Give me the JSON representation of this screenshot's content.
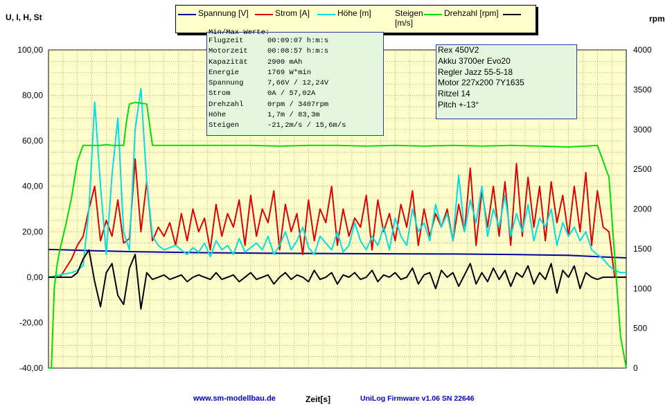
{
  "chart_data": {
    "type": "line",
    "left_axis_label": "U, I, H, St",
    "right_axis_label": "rpm",
    "xlabel": "Zeit[s]",
    "ylim_left": [
      -40,
      100
    ],
    "ylim_right": [
      0,
      4000
    ],
    "left_ticks": [
      "100,00",
      "80,00",
      "60,00",
      "40,00",
      "20,00",
      "0,00",
      "-20,00",
      "-40,00"
    ],
    "right_ticks": [
      "4000",
      "3500",
      "3000",
      "2500",
      "2000",
      "1500",
      "1000",
      "500",
      "0"
    ],
    "grid": true,
    "legend_position": "top",
    "x_range": [
      0,
      100
    ],
    "series": [
      {
        "name": "Spannung [V]",
        "color": "#0000a0",
        "axis": "left",
        "x": [
          0,
          3,
          8,
          15,
          25,
          40,
          50,
          60,
          70,
          80,
          90,
          97,
          100
        ],
        "y": [
          12.2,
          12.0,
          11.6,
          11.2,
          10.8,
          10.5,
          10.4,
          10.3,
          10.2,
          10.0,
          9.6,
          8.8,
          8.5
        ]
      },
      {
        "name": "Strom [A]",
        "color": "#e00000",
        "axis": "left",
        "x": [
          0,
          2,
          4,
          5,
          6,
          7,
          8,
          9,
          10,
          11,
          12,
          13,
          14,
          15,
          16,
          17,
          18,
          19,
          20,
          21,
          22,
          23,
          24,
          25,
          26,
          27,
          28,
          29,
          30,
          31,
          32,
          33,
          34,
          35,
          36,
          37,
          38,
          39,
          40,
          41,
          42,
          43,
          44,
          45,
          46,
          47,
          48,
          49,
          50,
          51,
          52,
          53,
          54,
          55,
          56,
          57,
          58,
          59,
          60,
          61,
          62,
          63,
          64,
          65,
          66,
          67,
          68,
          69,
          70,
          71,
          72,
          73,
          74,
          75,
          76,
          77,
          78,
          79,
          80,
          81,
          82,
          83,
          84,
          85,
          86,
          87,
          88,
          89,
          90,
          91,
          92,
          93,
          94,
          95,
          96,
          97,
          98,
          99,
          100
        ],
        "y": [
          0,
          0,
          8,
          14,
          18,
          30,
          40,
          16,
          25,
          18,
          34,
          15,
          17,
          52,
          20,
          42,
          16,
          22,
          18,
          24,
          14,
          28,
          16,
          30,
          20,
          26,
          12,
          32,
          18,
          28,
          22,
          34,
          14,
          36,
          18,
          30,
          24,
          38,
          12,
          32,
          20,
          28,
          10,
          34,
          16,
          30,
          24,
          40,
          14,
          30,
          18,
          26,
          22,
          36,
          12,
          34,
          20,
          28,
          16,
          32,
          22,
          38,
          14,
          30,
          18,
          28,
          22,
          30,
          16,
          32,
          20,
          48,
          14,
          38,
          22,
          40,
          18,
          42,
          14,
          50,
          18,
          44,
          22,
          40,
          16,
          42,
          24,
          36,
          18,
          40,
          20,
          46,
          14,
          38,
          22,
          20,
          0,
          0,
          0
        ]
      },
      {
        "name": "Höhe [m]",
        "color": "#00e0e0",
        "axis": "left",
        "x": [
          0,
          2,
          4,
          5,
          6,
          7,
          8,
          9,
          10,
          11,
          12,
          13,
          14,
          15,
          16,
          17,
          18,
          19,
          20,
          21,
          22,
          23,
          24,
          25,
          26,
          27,
          28,
          29,
          30,
          31,
          32,
          33,
          34,
          35,
          36,
          37,
          38,
          39,
          40,
          41,
          42,
          43,
          44,
          45,
          46,
          47,
          48,
          49,
          50,
          51,
          52,
          53,
          54,
          55,
          56,
          57,
          58,
          59,
          60,
          61,
          62,
          63,
          64,
          65,
          66,
          67,
          68,
          69,
          70,
          71,
          72,
          73,
          74,
          75,
          76,
          77,
          78,
          79,
          80,
          81,
          82,
          83,
          84,
          85,
          86,
          87,
          88,
          89,
          90,
          91,
          92,
          93,
          94,
          95,
          96,
          97,
          98,
          99,
          100
        ],
        "y": [
          0,
          1,
          2,
          3,
          5,
          30,
          77,
          40,
          10,
          45,
          70,
          20,
          12,
          65,
          83,
          42,
          18,
          14,
          12,
          13,
          14,
          12,
          10,
          13,
          11,
          15,
          9,
          16,
          12,
          14,
          10,
          17,
          11,
          13,
          15,
          12,
          18,
          10,
          14,
          20,
          12,
          16,
          22,
          13,
          10,
          18,
          15,
          12,
          20,
          11,
          14,
          24,
          16,
          12,
          18,
          14,
          22,
          12,
          26,
          18,
          14,
          30,
          20,
          24,
          16,
          32,
          22,
          28,
          16,
          45,
          20,
          34,
          24,
          40,
          18,
          30,
          22,
          36,
          18,
          28,
          20,
          32,
          16,
          26,
          22,
          30,
          14,
          24,
          18,
          22,
          16,
          20,
          12,
          10,
          8,
          5,
          3,
          2,
          2
        ]
      },
      {
        "name": "Steigen [m/s]",
        "color": "#000000",
        "axis": "left",
        "x": [
          0,
          2,
          4,
          5,
          6,
          7,
          8,
          9,
          10,
          11,
          12,
          13,
          14,
          15,
          16,
          17,
          18,
          19,
          20,
          21,
          22,
          23,
          24,
          25,
          26,
          27,
          28,
          29,
          30,
          31,
          32,
          33,
          34,
          35,
          36,
          37,
          38,
          39,
          40,
          41,
          42,
          43,
          44,
          45,
          46,
          47,
          48,
          49,
          50,
          51,
          52,
          53,
          54,
          55,
          56,
          57,
          58,
          59,
          60,
          61,
          62,
          63,
          64,
          65,
          66,
          67,
          68,
          69,
          70,
          71,
          72,
          73,
          74,
          75,
          76,
          77,
          78,
          79,
          80,
          81,
          82,
          83,
          84,
          85,
          86,
          87,
          88,
          89,
          90,
          91,
          92,
          93,
          94,
          95,
          96,
          97,
          98,
          99,
          100
        ],
        "y": [
          0,
          0,
          0,
          2,
          8,
          12,
          -2,
          -13,
          2,
          6,
          -8,
          -12,
          4,
          10,
          -14,
          2,
          -1,
          0,
          1,
          -1,
          0,
          1,
          -2,
          0,
          1,
          0,
          -1,
          2,
          -1,
          0,
          1,
          -2,
          0,
          2,
          -1,
          0,
          1,
          -3,
          0,
          2,
          -1,
          1,
          0,
          -2,
          3,
          -1,
          0,
          2,
          -3,
          1,
          0,
          2,
          -1,
          0,
          3,
          -2,
          1,
          0,
          2,
          -1,
          0,
          4,
          -3,
          1,
          2,
          -5,
          3,
          0,
          2,
          -4,
          1,
          6,
          -3,
          2,
          -2,
          4,
          -1,
          3,
          -4,
          2,
          0,
          5,
          -3,
          2,
          -1,
          6,
          -7,
          3,
          0,
          5,
          -5,
          2,
          0,
          -1,
          0,
          0,
          0,
          0,
          0
        ]
      },
      {
        "name": "Drehzahl [rpm]",
        "color": "#00e000",
        "axis": "right",
        "x": [
          0,
          0.5,
          1,
          1.5,
          2,
          3,
          4,
          5,
          6,
          7,
          8,
          9,
          10,
          11,
          12,
          13,
          13.5,
          14,
          15,
          16,
          17,
          18,
          20,
          25,
          30,
          35,
          40,
          45,
          50,
          55,
          60,
          65,
          70,
          75,
          80,
          85,
          90,
          93,
          95,
          97,
          98,
          99,
          100
        ],
        "y": [
          0,
          0,
          1000,
          1300,
          1500,
          1800,
          2150,
          2600,
          2800,
          2800,
          2800,
          2800,
          2810,
          2800,
          2800,
          2800,
          3100,
          3320,
          3340,
          3330,
          3320,
          2800,
          2800,
          2800,
          2800,
          2800,
          2790,
          2800,
          2800,
          2790,
          2800,
          2790,
          2800,
          2790,
          2800,
          2790,
          2780,
          2790,
          2800,
          2400,
          1400,
          400,
          0
        ]
      }
    ]
  },
  "legend": {
    "spannung": "Spannung [V]",
    "strom": "Strom [A]",
    "hoehe": "Höhe [m]",
    "steigen": "Steigen [m/s]",
    "drehzahl": "Drehzahl [rpm]"
  },
  "minmax": {
    "title": "Min/Max Werte:",
    "rows": [
      {
        "label": "Flugzeit",
        "value": "00:09:07 h:m:s"
      },
      {
        "label": "Motorzeit",
        "value": "00:08:57 h:m:s"
      },
      {
        "label": "Kapazität",
        "value": "2900 mAh"
      },
      {
        "label": "Energie",
        "value": "1769 W*min"
      },
      {
        "label": "Spannung",
        "value": "7,66V / 12,24V"
      },
      {
        "label": "Strom",
        "value": "0A / 57,02A"
      },
      {
        "label": "Drehzahl",
        "value": "0rpm / 3407rpm"
      },
      {
        "label": "Höhe",
        "value": "1,7m / 83,3m"
      },
      {
        "label": "Steigen",
        "value": "-21,2m/s / 15,6m/s"
      }
    ]
  },
  "model": {
    "lines": [
      "Rex 450V2",
      "Akku 3700er Evo20",
      "Regler Jazz 55-5-18",
      "Motor 227x200 7Y1635",
      "Ritzel 14",
      "Pitch +-13°"
    ]
  },
  "footer": {
    "website": "www.sm-modellbau.de",
    "xlabel": "Zeit[s]",
    "firmware": "UniLog Firmware v1.06 SN 22646"
  },
  "colors": {
    "plot_background": "#ffffcc",
    "grid": "#808080",
    "link": "#0000cc"
  }
}
